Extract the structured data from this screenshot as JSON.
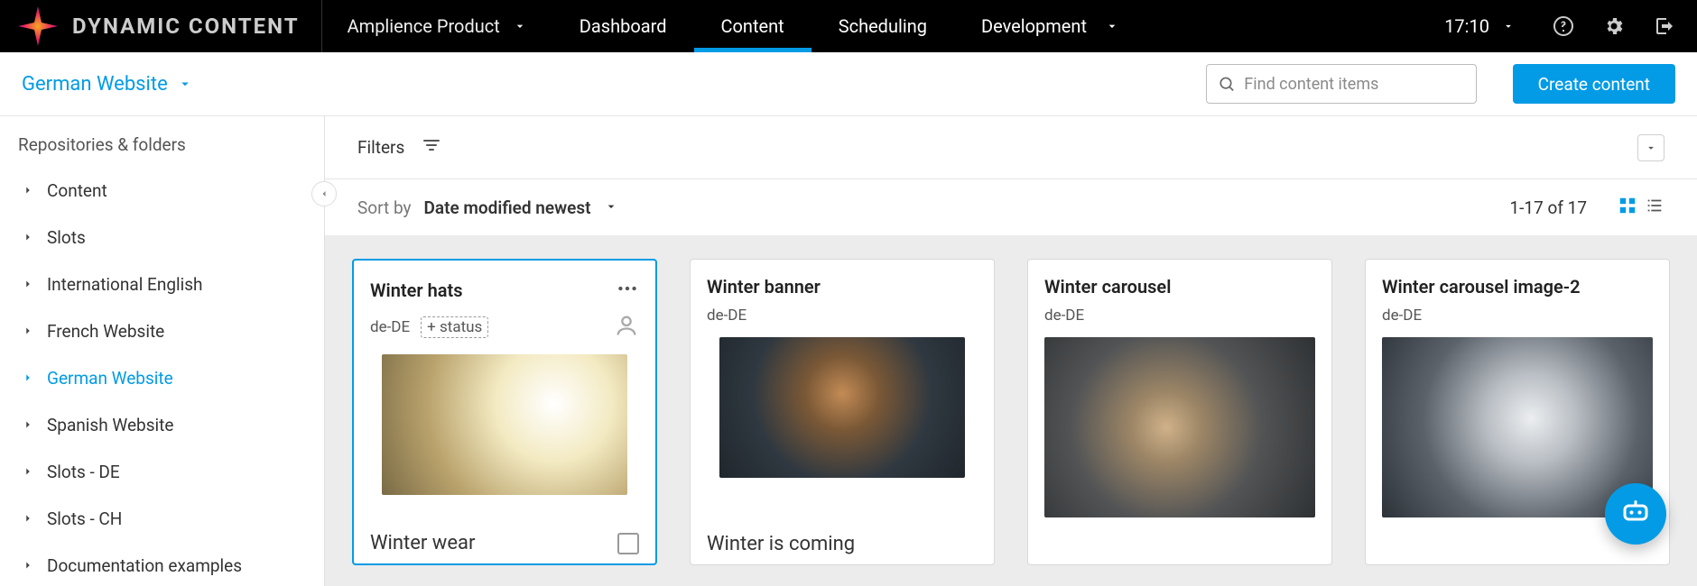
{
  "brand": {
    "name": "DYNAMIC CONTENT",
    "product": "Amplience Product"
  },
  "nav": {
    "tabs": [
      {
        "label": "Dashboard",
        "name": "tab-dashboard"
      },
      {
        "label": "Content",
        "name": "tab-content",
        "active": true
      },
      {
        "label": "Scheduling",
        "name": "tab-scheduling"
      }
    ],
    "env": "Development"
  },
  "clock": "17:10",
  "subheader": {
    "repository_label": "German Website",
    "search_placeholder": "Find content items",
    "create_label": "Create content"
  },
  "sidebar": {
    "title": "Repositories & folders",
    "items": [
      {
        "label": "Content"
      },
      {
        "label": "Slots"
      },
      {
        "label": "International English"
      },
      {
        "label": "French Website"
      },
      {
        "label": "German Website",
        "active": true
      },
      {
        "label": "Spanish Website"
      },
      {
        "label": "Slots - DE"
      },
      {
        "label": "Slots - CH"
      },
      {
        "label": "Documentation examples"
      }
    ]
  },
  "filters": {
    "label": "Filters"
  },
  "sort": {
    "label": "Sort by",
    "value": "Date modified newest",
    "count_text": "1-17 of 17"
  },
  "cards": [
    {
      "title": "Winter hats",
      "locale": "de-DE",
      "status_extra": "+ status",
      "caption": "Winter wear",
      "menu": true,
      "assignee": true,
      "thumbClass": "ph-a",
      "thumbW": 272,
      "selected": true,
      "checkable": true
    },
    {
      "title": "Winter banner",
      "locale": "de-DE",
      "caption": "Winter is coming",
      "thumbClass": "ph-b",
      "thumbW": 272
    },
    {
      "title": "Winter carousel",
      "locale": "de-DE",
      "thumbClass": "ph-c",
      "thumbW": 302
    },
    {
      "title": "Winter carousel image-2",
      "locale": "de-DE",
      "thumbClass": "ph-d",
      "thumbW": 302
    }
  ]
}
